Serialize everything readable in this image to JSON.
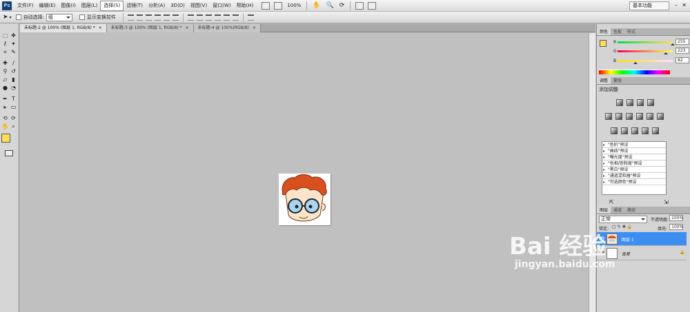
{
  "menubar": {
    "logo": "Ps",
    "items": [
      "文件(F)",
      "编辑(E)",
      "图像(I)",
      "图层(L)",
      "选择(S)",
      "滤镜(T)",
      "分析(A)",
      "3D(D)",
      "视图(V)",
      "窗口(W)",
      "帮助(H)"
    ],
    "active_index": 4,
    "zoom": "100%",
    "workspace": "基本功能"
  },
  "options": {
    "auto_select_label": "自动选择:",
    "auto_select_value": "组",
    "transform_label": "显示变换控件"
  },
  "tabs": [
    {
      "label": "未标题-2 @ 100% (图层 1, RGB/8) *",
      "close": "×"
    },
    {
      "label": "未标题-3 @ 100% (图层 1, RGB/8) *",
      "close": "×"
    },
    {
      "label": "未标题-4 @ 100%(RGB/8)",
      "close": "×"
    }
  ],
  "color_panel": {
    "tabs": [
      "颜色",
      "色板",
      "样式"
    ],
    "r_label": "R",
    "r_value": "255",
    "g_label": "G",
    "g_value": "223",
    "b_label": "B",
    "b_value": "82",
    "r": 255,
    "g": 223,
    "b": 82,
    "foreground": "#ffdf52"
  },
  "adjust_panel": {
    "tabs": [
      "调整",
      "蒙版"
    ],
    "title": "添加调整",
    "presets": [
      "\"色阶\"预设",
      "\"曲线\"预设",
      "\"曝光度\"预设",
      "\"色相/饱和度\"预设",
      "\"黑白\"预设",
      "\"通道混和器\"预设",
      "\"可选颜色\"预设"
    ]
  },
  "layers_panel": {
    "tabs": [
      "图层",
      "通道",
      "路径"
    ],
    "blend_mode": "正常",
    "opacity_label": "不透明度:",
    "opacity_value": "100%",
    "lock_label": "锁定:",
    "fill_label": "填充:",
    "fill_value": "100%",
    "layers": [
      {
        "name": "图层 1",
        "selected": true
      },
      {
        "name": "背景",
        "selected": false
      }
    ]
  },
  "watermark": {
    "brand": "Bai 经验",
    "url": "jingyan.baidu.com"
  }
}
